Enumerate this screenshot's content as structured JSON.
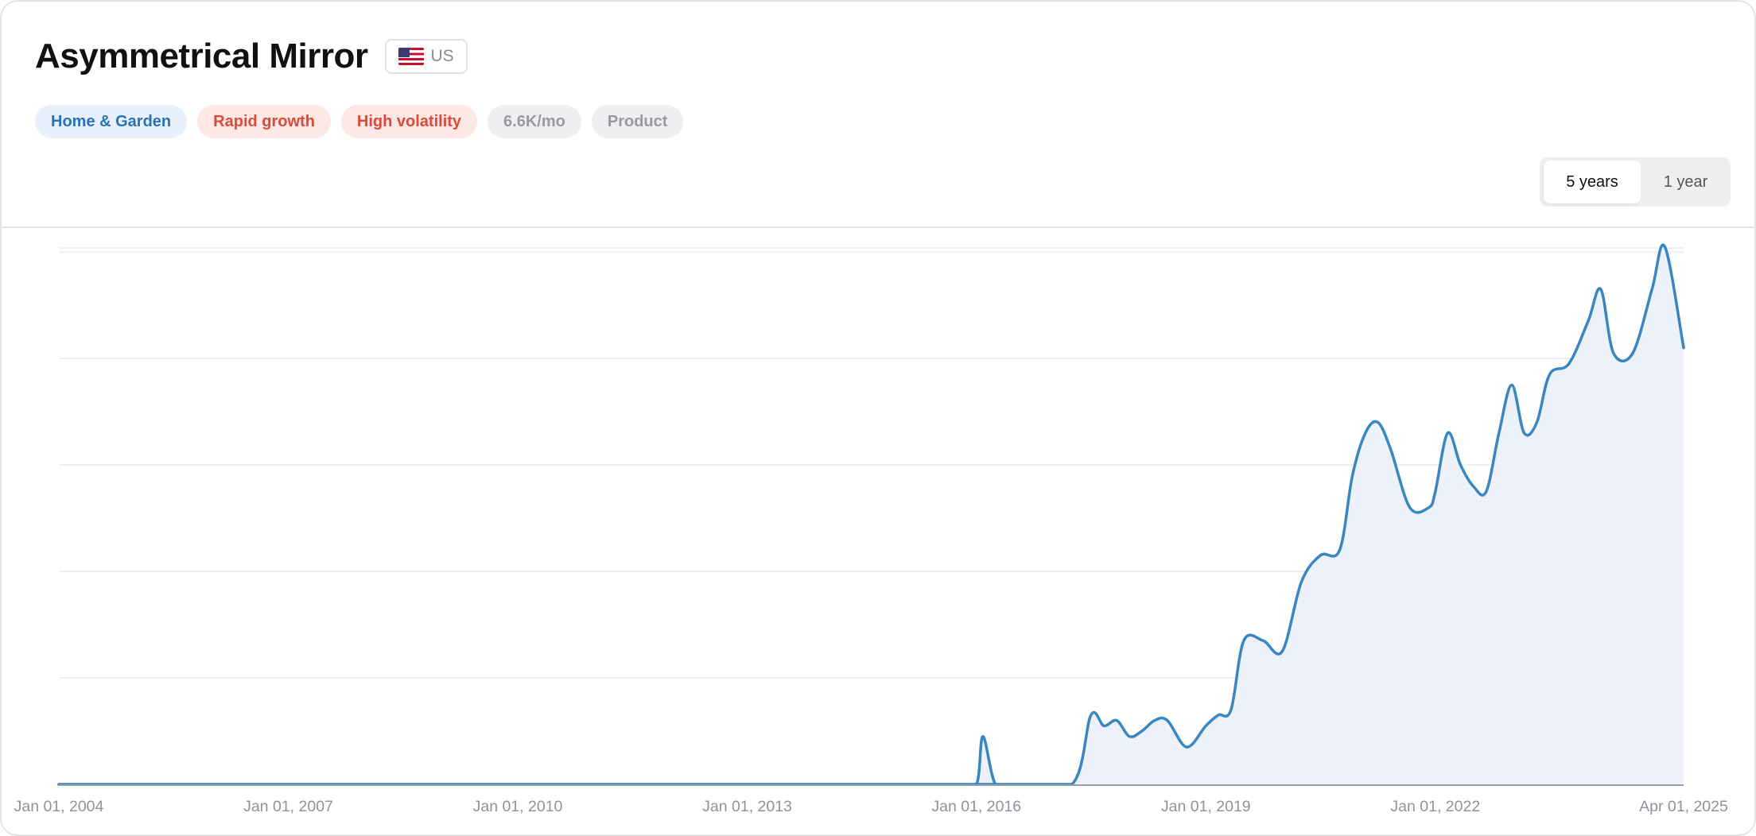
{
  "header": {
    "title": "Asymmetrical Mirror",
    "country": {
      "code": "US",
      "flag_icon": "us-flag-icon"
    }
  },
  "tags": [
    {
      "label": "Home & Garden",
      "style": "blue"
    },
    {
      "label": "Rapid growth",
      "style": "red"
    },
    {
      "label": "High volatility",
      "style": "red"
    },
    {
      "label": "6.6K/mo",
      "style": "gray"
    },
    {
      "label": "Product",
      "style": "gray"
    }
  ],
  "range_toggle": {
    "options": [
      "5 years",
      "1 year"
    ],
    "selected": "5 years"
  },
  "colors": {
    "line": "#3a86c0",
    "area": "#edf2fa",
    "grid": "#ececef",
    "axis": "#9aa0a8"
  },
  "chart_data": {
    "type": "area",
    "title": "",
    "xlabel": "",
    "ylabel": "",
    "x_tick_labels": [
      "Jan 01, 2004",
      "Jan 01, 2007",
      "Jan 01, 2010",
      "Jan 01, 2013",
      "Jan 01, 2016",
      "Jan 01, 2019",
      "Jan 01, 2022",
      "Apr 01, 2025"
    ],
    "x_tick_dates": [
      "2004-01-01",
      "2007-01-01",
      "2010-01-01",
      "2013-01-01",
      "2016-01-01",
      "2019-01-01",
      "2022-01-01",
      "2025-04-01"
    ],
    "xlim": [
      "2004-01-01",
      "2025-04-01"
    ],
    "ylim": [
      0,
      100
    ],
    "y_tick_labels_visible": false,
    "grid": true,
    "series": [
      {
        "x": [
          "2004-01-01",
          "2015-10-01",
          "2016-01-01",
          "2016-02-01",
          "2016-04-01",
          "2016-07-01",
          "2017-04-01",
          "2017-07-01",
          "2017-09-01",
          "2017-11-01",
          "2018-01-01",
          "2018-03-01",
          "2018-05-01",
          "2018-07-01",
          "2018-10-01",
          "2019-01-01",
          "2019-03-01",
          "2019-05-01",
          "2019-07-01",
          "2019-10-01",
          "2020-01-01",
          "2020-04-01",
          "2020-07-01",
          "2020-10-01",
          "2020-12-01",
          "2021-02-01",
          "2021-04-01",
          "2021-06-01",
          "2021-09-01",
          "2021-12-01",
          "2022-01-01",
          "2022-03-01",
          "2022-05-01",
          "2022-07-01",
          "2022-09-01",
          "2022-11-01",
          "2023-01-01",
          "2023-03-01",
          "2023-05-01",
          "2023-07-01",
          "2023-10-01",
          "2024-01-01",
          "2024-03-01",
          "2024-05-01",
          "2024-08-01",
          "2024-11-01",
          "2025-01-01",
          "2025-04-01"
        ],
        "y": [
          0,
          0,
          0,
          9,
          0,
          0,
          0,
          13,
          11,
          12,
          9,
          10,
          12,
          12,
          7,
          11,
          13,
          14,
          27,
          27,
          25,
          38,
          43,
          44,
          58,
          66,
          68,
          63,
          52,
          52,
          55,
          66,
          60,
          56,
          55,
          66,
          75,
          66,
          68,
          77,
          79,
          87,
          93,
          81,
          81,
          93,
          101,
          82
        ]
      }
    ]
  }
}
